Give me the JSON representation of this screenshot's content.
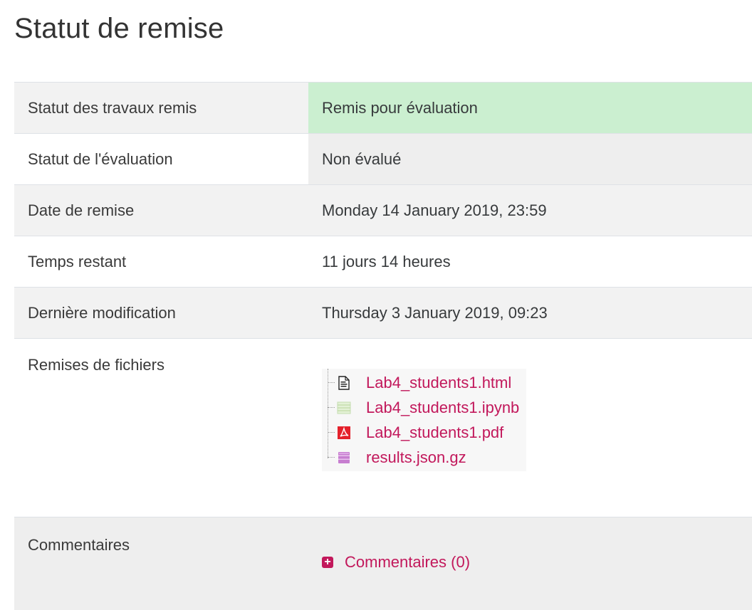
{
  "page": {
    "title": "Statut de remise"
  },
  "rows": [
    {
      "label": "Statut des travaux remis",
      "value": "Remis pour évaluation",
      "status_color": "#cbefd0"
    },
    {
      "label": "Statut de l'évaluation",
      "value": "Non évalué"
    },
    {
      "label": "Date de remise",
      "value": "Monday 14 January 2019, 23:59"
    },
    {
      "label": "Temps restant",
      "value": "11 jours 14 heures"
    },
    {
      "label": "Dernière modification",
      "value": "Thursday 3 January 2019, 09:23"
    }
  ],
  "files": {
    "label": "Remises de fichiers",
    "items": [
      {
        "name": "Lab4_students1.html",
        "icon": "html-file-icon"
      },
      {
        "name": "Lab4_students1.ipynb",
        "icon": "spreadsheet-file-icon"
      },
      {
        "name": "Lab4_students1.pdf",
        "icon": "pdf-file-icon"
      },
      {
        "name": "results.json.gz",
        "icon": "archive-file-icon"
      }
    ]
  },
  "comments": {
    "label": "Commentaires",
    "link": "Commentaires (0)",
    "icon": "plus-square-icon"
  },
  "colors": {
    "link": "#c2185b",
    "submitted_bg": "#cbefd0"
  }
}
